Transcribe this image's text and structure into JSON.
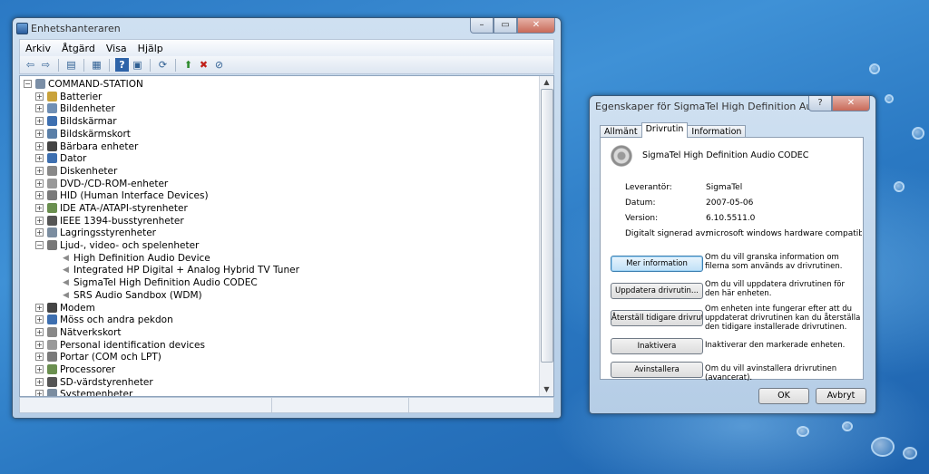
{
  "device_manager": {
    "title": "Enhetshanteraren",
    "caption_buttons": {
      "minimize": "–",
      "maximize": "▭",
      "close": "✕"
    },
    "menu": [
      "Arkiv",
      "Åtgärd",
      "Visa",
      "Hjälp"
    ],
    "toolbar_icons": [
      "back-icon",
      "forward-icon",
      "show-hide-tree-icon",
      "properties-icon",
      "help-icon",
      "scan-hardware-icon",
      "update-driver-icon",
      "uninstall-icon",
      "disable-icon"
    ],
    "tree": {
      "root": "COMMAND-STATION",
      "items": [
        {
          "label": "Batterier",
          "expanded": false
        },
        {
          "label": "Bildenheter",
          "expanded": false
        },
        {
          "label": "Bildskärmar",
          "expanded": false
        },
        {
          "label": "Bildskärmskort",
          "expanded": false
        },
        {
          "label": "Bärbara enheter",
          "expanded": false
        },
        {
          "label": "Dator",
          "expanded": false
        },
        {
          "label": "Diskenheter",
          "expanded": false
        },
        {
          "label": "DVD-/CD-ROM-enheter",
          "expanded": false
        },
        {
          "label": "HID (Human Interface Devices)",
          "expanded": false
        },
        {
          "label": "IDE ATA-/ATAPI-styrenheter",
          "expanded": false
        },
        {
          "label": "IEEE 1394-busstyrenheter",
          "expanded": false
        },
        {
          "label": "Lagringsstyrenheter",
          "expanded": false
        },
        {
          "label": "Ljud-, video- och spelenheter",
          "expanded": true
        },
        {
          "label": "High Definition Audio Device",
          "child": true
        },
        {
          "label": "Integrated HP Digital + Analog Hybrid TV Tuner",
          "child": true
        },
        {
          "label": "SigmaTel High Definition Audio CODEC",
          "child": true
        },
        {
          "label": "SRS Audio Sandbox (WDM)",
          "child": true
        },
        {
          "label": "Modem",
          "expanded": false
        },
        {
          "label": "Möss och andra pekdon",
          "expanded": false
        },
        {
          "label": "Nätverkskort",
          "expanded": false
        },
        {
          "label": "Personal identification devices",
          "expanded": false
        },
        {
          "label": "Portar (COM och LPT)",
          "expanded": false
        },
        {
          "label": "Processorer",
          "expanded": false
        },
        {
          "label": "SD-värdstyrenheter",
          "expanded": false
        },
        {
          "label": "Systemenheter",
          "expanded": false
        }
      ]
    }
  },
  "properties_dialog": {
    "title": "Egenskaper för SigmaTel High Definition Audio CODEC",
    "caption_buttons": {
      "help": "?",
      "close": "✕"
    },
    "tabs": [
      "Allmänt",
      "Drivrutin",
      "Information"
    ],
    "active_tab": "Drivrutin",
    "device_name": "SigmaTel High Definition Audio CODEC",
    "fields": [
      {
        "key": "Leverantör:",
        "value": "SigmaTel"
      },
      {
        "key": "Datum:",
        "value": "2007-05-06"
      },
      {
        "key": "Version:",
        "value": "6.10.5511.0"
      },
      {
        "key": "Digitalt signerad av:",
        "value": "microsoft windows hardware compatibility publisher"
      }
    ],
    "actions": [
      {
        "button": "Mer information",
        "description": "Om du vill granska information om filerna som används av drivrutinen."
      },
      {
        "button": "Uppdatera drivrutin...",
        "description": "Om du vill uppdatera drivrutinen för den här enheten."
      },
      {
        "button": "Återställ tidigare drivrutin",
        "description": "Om enheten inte fungerar efter att du uppdaterat drivrutinen kan du återställa den tidigare installerade drivrutinen."
      },
      {
        "button": "Inaktivera",
        "description": "Inaktiverar den markerade enheten."
      },
      {
        "button": "Avinstallera",
        "description": "Om du vill avinstallera drivrutinen (avancerat)."
      }
    ],
    "ok_label": "OK",
    "cancel_label": "Avbryt"
  }
}
